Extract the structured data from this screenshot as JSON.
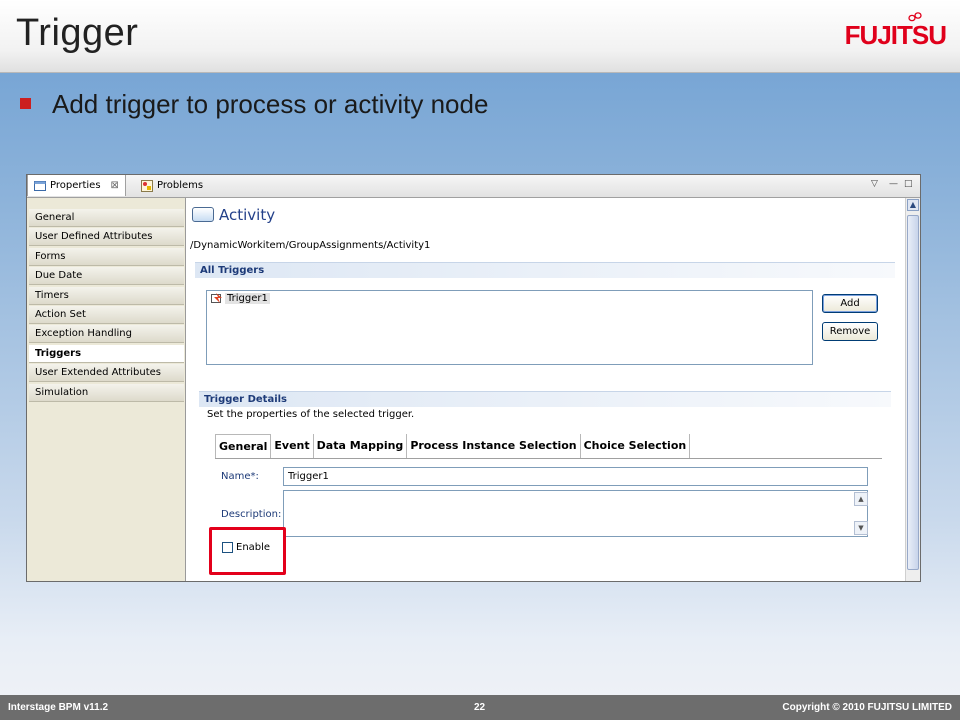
{
  "slide": {
    "title": "Trigger",
    "logo_text": "FUJITSU",
    "bullet": "Add trigger to process or activity node"
  },
  "colors": {
    "brand_red": "#e0001b",
    "bullet_red": "#cc1f1f",
    "footer_bg": "#6d6d6d",
    "highlight": "#e3001b"
  },
  "view_tabs": [
    {
      "label": "Properties",
      "icon": "properties-icon",
      "close": "⊠"
    },
    {
      "label": "Problems",
      "icon": "problems-icon"
    }
  ],
  "view_controls": [
    "▽",
    "—",
    "□"
  ],
  "sidebar": {
    "items": [
      "General",
      "User Defined Attributes",
      "Forms",
      "Due Date",
      "Timers",
      "Action Set",
      "Exception Handling",
      "Triggers",
      "User Extended Attributes",
      "Simulation"
    ],
    "selected": "Triggers"
  },
  "activity": {
    "title": "Activity",
    "path": "/DynamicWorkitem/GroupAssignments/Activity1"
  },
  "all_triggers": {
    "heading": "All Triggers",
    "items": [
      "Trigger1"
    ],
    "add_button": "Add",
    "remove_button": "Remove"
  },
  "trigger_details": {
    "heading": "Trigger Details",
    "description": "Set the properties of the selected trigger.",
    "tabs": [
      "General",
      "Event",
      "Data Mapping",
      "Process Instance Selection",
      "Choice Selection"
    ],
    "active_tab": "General",
    "name_label": "Name*:",
    "name_value": "Trigger1",
    "description_label": "Description:",
    "description_value": "",
    "enable_label": "Enable",
    "enable_checked": false
  },
  "footer": {
    "left": "Interstage BPM v11.2",
    "page": "22",
    "right": "Copyright © 2010 FUJITSU LIMITED"
  }
}
